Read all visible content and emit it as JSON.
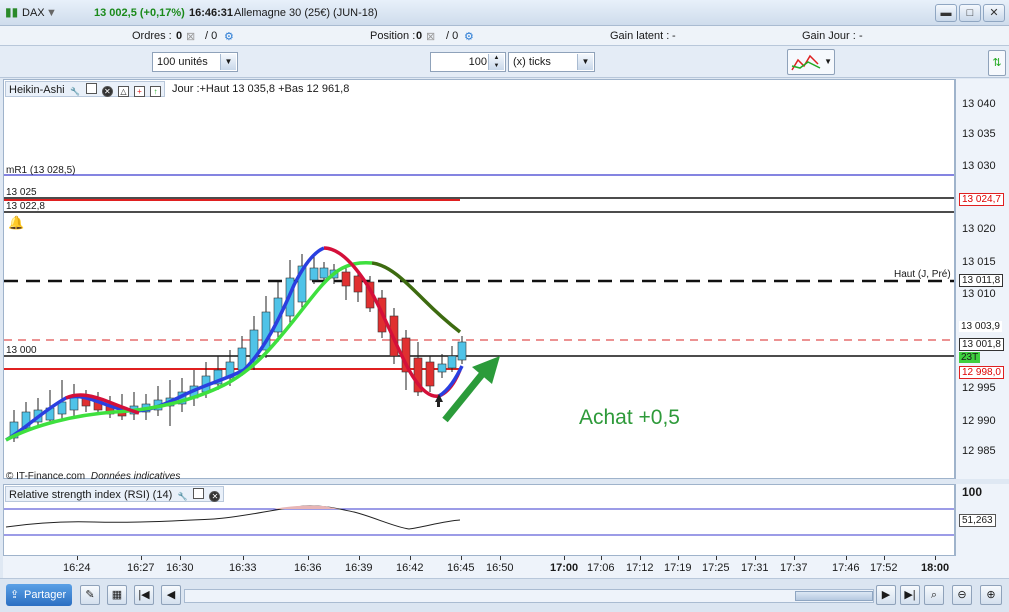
{
  "header": {
    "symbol": "DAX",
    "price": "13 002,5 (+0,17%)",
    "time": "16:46:31",
    "instrument": "Allemagne 30 (25€) (JUN-18)"
  },
  "orders": {
    "ordres_label": "Ordres :",
    "ordres_value": "0",
    "ordres_total": "/ 0",
    "position_label": "Position :",
    "position_value": "0",
    "position_total": "/ 0",
    "gain_latent_label": "Gain latent :",
    "gain_latent_value": "-",
    "gain_jour_label": "Gain Jour :",
    "gain_jour_value": "-"
  },
  "toolbar": {
    "units_select": "100 unités",
    "ticks_value": "100",
    "ticks_select": "(x) ticks"
  },
  "chart": {
    "indicator_name": "Heikin-Ashi",
    "info": "Jour :+Haut 13 035,8 +Bas 12 961,8",
    "line_mr1": "mR1 (13 028,5)",
    "line_13025": "13 025",
    "line_13022": "13 022,8",
    "line_13000": "13 000",
    "line_haut": "Haut (J, Pré)",
    "annotation": "Achat +0,5",
    "copyright": "© IT-Finance.com",
    "disclaimer": "Données indicatives",
    "yticks": [
      "13 040",
      "13 035",
      "13 030",
      "13 020",
      "13 015",
      "13 010",
      "12 995",
      "12 990",
      "12 985"
    ],
    "price_tags": {
      "t1": "13 024,7",
      "t2": "13 011,8",
      "t3": "13 003,9",
      "t4": "13 001,8",
      "t5": "23T",
      "t6": "12 998,0"
    }
  },
  "rsi": {
    "label": "Relative strength index (RSI) (14)",
    "axis_top": "100",
    "value": "51,263"
  },
  "xaxis": {
    "labels": [
      "16:24",
      "16:27",
      "16:30",
      "16:33",
      "16:36",
      "16:39",
      "16:42",
      "16:45",
      "16:50",
      "17:00",
      "17:06",
      "17:12",
      "17:19",
      "17:25",
      "17:31",
      "17:37",
      "17:46",
      "17:52",
      "18:00"
    ]
  },
  "bottom": {
    "share_label": "Partager"
  },
  "colors": {
    "bull_candle": "#4fc3e8",
    "bear_candle": "#e03030",
    "ma_blue": "#2a3fe0",
    "ma_green": "#3ee03e",
    "ma_red": "#d4103a",
    "ma_dark": "#3d6b10",
    "arrow": "#2b9b3a",
    "annotation": "#2e9a3a"
  }
}
